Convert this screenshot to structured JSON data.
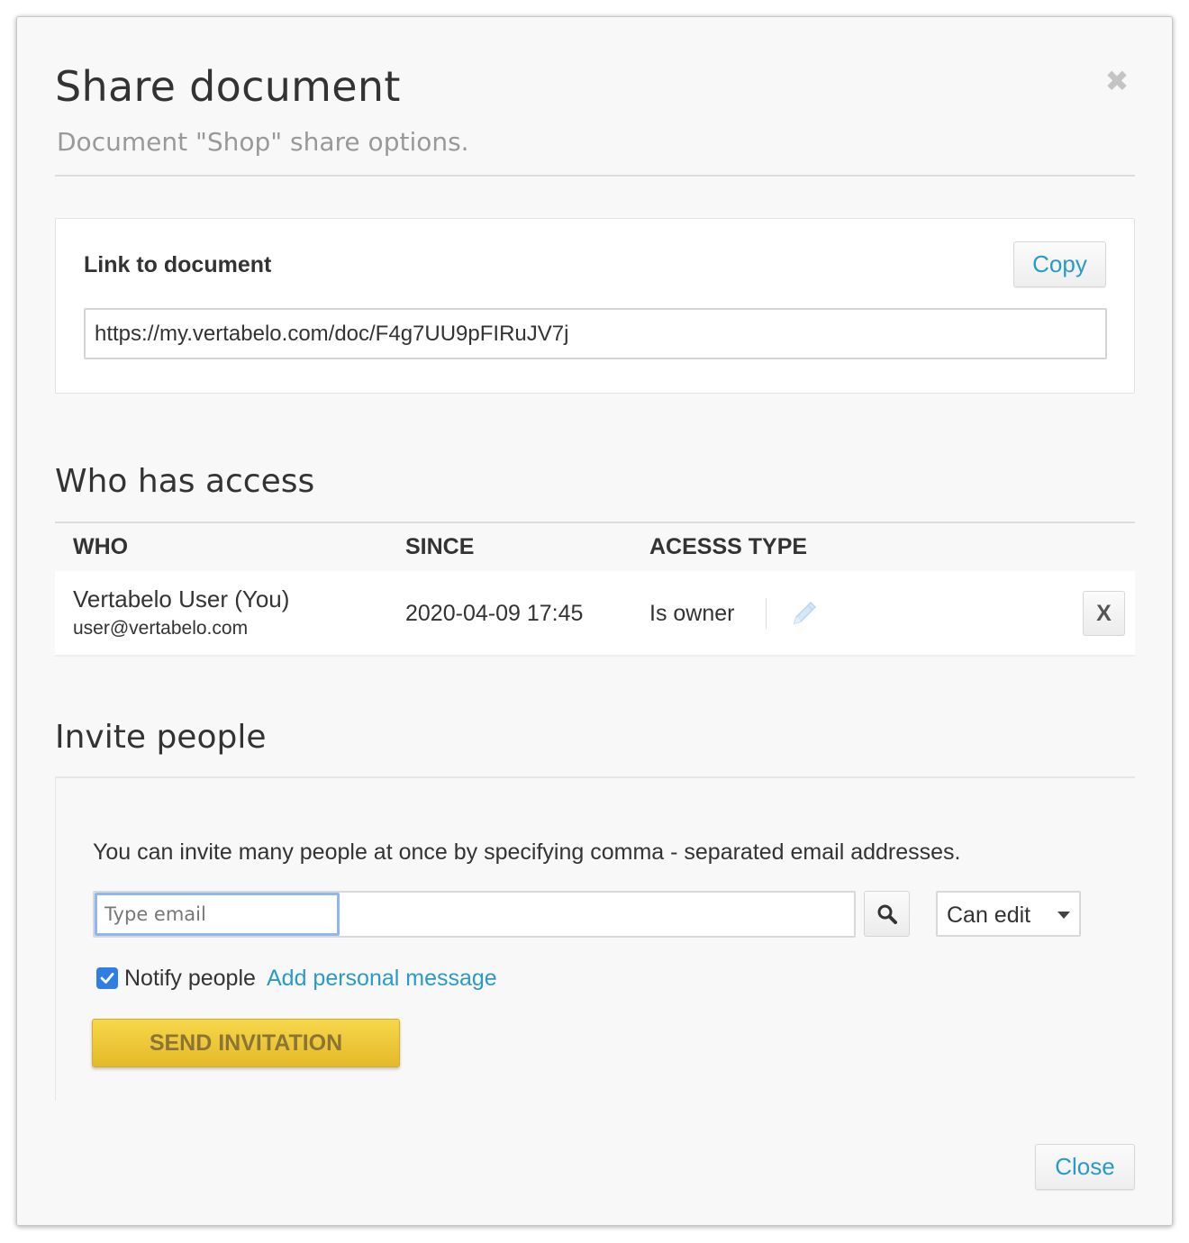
{
  "dialog": {
    "title": "Share document",
    "subtitle": "Document \"Shop\" share options.",
    "close_icon": "close-x-icon",
    "close_glyph": "✖"
  },
  "link": {
    "label": "Link to document",
    "copy_label": "Copy",
    "url": "https://my.vertabelo.com/doc/F4g7UU9pFIRuJV7j"
  },
  "access": {
    "title": "Who has access",
    "columns": [
      "WHO",
      "SINCE",
      "ACESSS TYPE"
    ],
    "rows": [
      {
        "name": "Vertabelo User (You)",
        "email": "user@vertabelo.com",
        "since": "2020-04-09 17:45",
        "type": "Is owner",
        "edit_icon": "pencil-icon",
        "remove_label": "X"
      }
    ]
  },
  "invite": {
    "title": "Invite people",
    "hint": "You can invite many people at once by specifying comma - separated email addresses.",
    "email_placeholder": "Type email",
    "search_icon": "search-icon",
    "permission": "Can edit",
    "notify_checked": true,
    "notify_label": "Notify people",
    "personal_message_link": "Add personal message",
    "send_label": "SEND INVITATION"
  },
  "footer": {
    "close_label": "Close"
  },
  "colors": {
    "link_blue": "#2a9ac7",
    "send_yellow": "#f2cd3e",
    "checkbox_blue": "#2f7fe3",
    "focus_border": "#8fb8ef"
  }
}
